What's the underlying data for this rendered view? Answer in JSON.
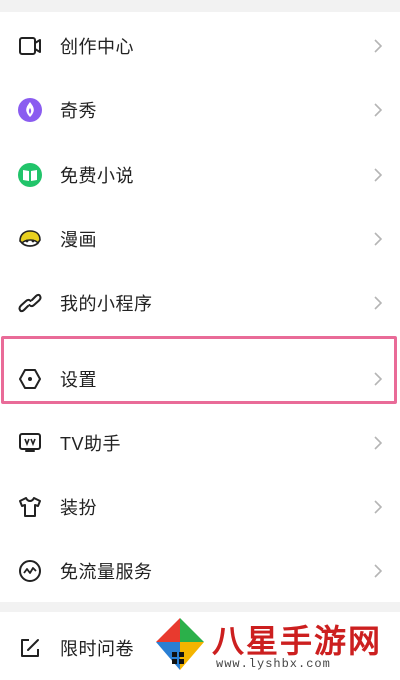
{
  "menu": {
    "items": [
      {
        "label": "创作中心",
        "icon": "video-icon"
      },
      {
        "label": "奇秀",
        "icon": "flame-icon"
      },
      {
        "label": "免费小说",
        "icon": "book-icon"
      },
      {
        "label": "漫画",
        "icon": "comic-icon"
      },
      {
        "label": "我的小程序",
        "icon": "link-icon"
      },
      {
        "label": "设置",
        "icon": "settings-icon"
      },
      {
        "label": "TV助手",
        "icon": "tv-icon"
      },
      {
        "label": "装扮",
        "icon": "shirt-icon"
      },
      {
        "label": "免流量服务",
        "icon": "data-icon"
      },
      {
        "label": "限时问卷",
        "icon": "edit-icon"
      }
    ]
  },
  "watermark": {
    "title": "八星手游网",
    "url": "www.lyshbx.com"
  },
  "colors": {
    "highlight": "#e96b98",
    "text": "#222222",
    "chevron": "#b5b5b5",
    "flame": "#8a5cf0",
    "book": "#21c46a",
    "comic": "#e8d020"
  }
}
